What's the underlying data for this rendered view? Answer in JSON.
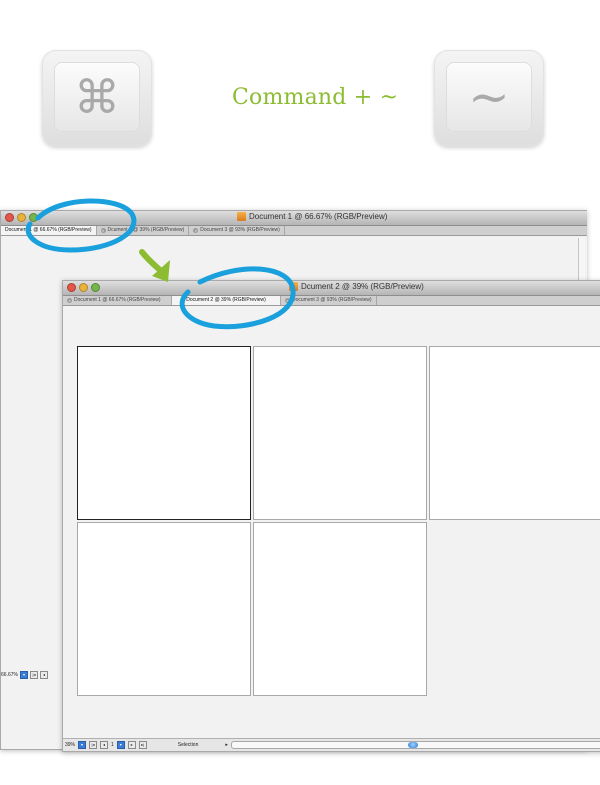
{
  "shortcut": {
    "command_symbol": "⌘",
    "tilde_symbol": "~",
    "label": "Command + ~"
  },
  "window1": {
    "title": "Document 1 @ 66.67% (RGB/Preview)",
    "tabs": [
      {
        "label": "Document 1 @ 66.67% (RGB/Preview)",
        "active": true
      },
      {
        "label": "Dcument 2 @ 39% (RGB/Preview)",
        "active": false
      },
      {
        "label": "Document 3 @ 93% (RGB/Preview)",
        "active": false
      }
    ],
    "zoom": "66.67%",
    "nav_prev": "◂",
    "nav_first": "|◂"
  },
  "window2": {
    "title": "Dcument 2 @ 39% (RGB/Preview)",
    "tabs": [
      {
        "label": "Document 1 @ 66.67% (RGB/Preview)",
        "active": false
      },
      {
        "label": "Document 2 @ 39% (RGB/Preview)",
        "active": true
      },
      {
        "label": "Document 3 @ 93% (RGB/Preview)",
        "active": false
      }
    ],
    "zoom": "39%",
    "page": "1",
    "tool": "Selection"
  },
  "colors": {
    "accent_green": "#8cbc32",
    "highlight_blue": "#1aa0dc",
    "arrow_green": "#8cbc32"
  }
}
